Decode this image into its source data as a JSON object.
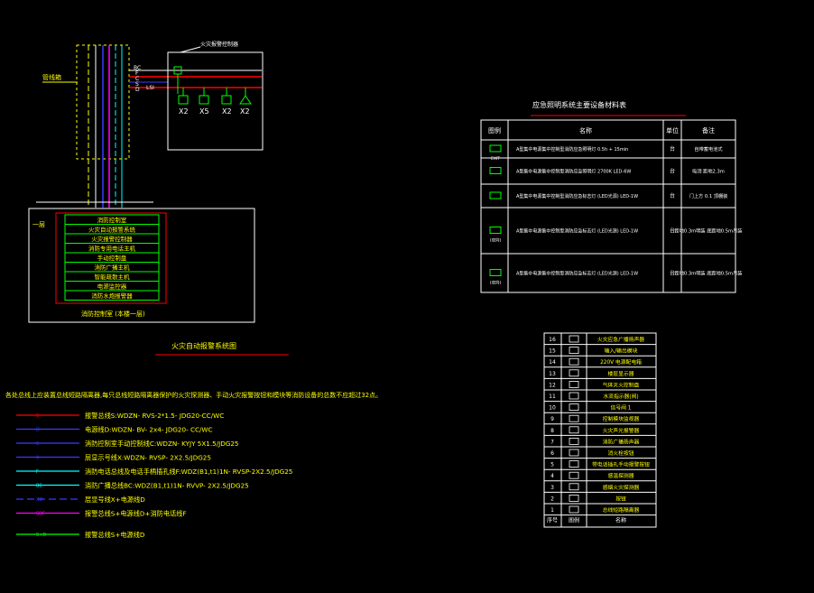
{
  "colors": {
    "background": "#000000",
    "white": "#ffffff",
    "yellow": "#ffff00",
    "green": "#00ff00",
    "red": "#ff0000",
    "cyan": "#00ffff",
    "magenta": "#ff00ff",
    "blue": "#3a3aff",
    "gray": "#9a9a9a"
  },
  "riser": {
    "shaft_label": "管线箱",
    "box_label": "火灾报警控制器",
    "floor_label": "一层",
    "line_tags": [
      "BC",
      "F",
      "C",
      "S",
      "D"
    ],
    "module_tag": "LSI",
    "devices": [
      "X2",
      "X5",
      "X2",
      "X2"
    ],
    "panel_items": [
      "消防控制室",
      "火灾自动报警系统",
      "火灾报警控制器",
      "消防专用电话主机",
      "手动控制盘",
      "消防广播主机",
      "智能疏散主机",
      "电源监控器",
      "消防水炮报警器"
    ],
    "panel_footer": "消防控制室    (本楼一层)",
    "title": "火灾自动报警系统图"
  },
  "notes": {
    "main": "各处总线上应装置总线短路隔离器,每只总线短路隔离器保护的火灾探测器、手动火灾报警按钮和模块等消防设备的总数不应超过32点。"
  },
  "legend": [
    {
      "tag": "S",
      "text": "报警总线S:WDZN- RVS-2*1.5- JDG20-CC/WC",
      "color": "red",
      "dashed": false
    },
    {
      "tag": "D",
      "text": "电源线D:WDZN- BV- 2x4- JDG20- CC/WC",
      "color": "blue",
      "dashed": false
    },
    {
      "tag": "C",
      "text": "消防控制室手动控制线C:WDZN- KYJY 5X1.5/JDG25",
      "color": "blue",
      "dashed": false
    },
    {
      "tag": "X",
      "text": "层显示号线X:WDZN- RVSP- 2X2.5/JDG25",
      "color": "blue",
      "dashed": false
    },
    {
      "tag": "F",
      "text": "消防电话总线及电话手柄插孔线F:WDZ(B1,t1)1N- RVSP-2X2.5/JDG25",
      "color": "cyan",
      "dashed": false
    },
    {
      "tag": "BC",
      "text": "消防广播总线BC:WDZ(B1,t1)1N- RVVP- 2X2.5/JDG25",
      "color": "cyan",
      "dashed": false
    },
    {
      "tag": "XD",
      "text": "层显号线X+电源线D",
      "color": "blue",
      "dashed": true
    },
    {
      "tag": "SDF",
      "text": "报警总线S+电源线D+消防电话线F",
      "color": "magenta",
      "dashed": false
    },
    {
      "tag": "S+D",
      "text": "报警总线S+电源线D",
      "color": "green",
      "dashed": false
    }
  ],
  "materials": {
    "title": "应急照明系统主要设备材料表",
    "headers": [
      "图例",
      "名称",
      "单位",
      "备注"
    ],
    "rows": [
      {
        "legend": "EXIT",
        "name": "A型集中电源集中控制型消防应急照明灯 0.5h + 15min",
        "unit": "台",
        "note": "自带蓄电池式"
      },
      {
        "legend": "",
        "name": "A型集中电源集中控制型消防应急照明灯 2700K LED-6W",
        "unit": "台",
        "note": "吸顶 距地2.3m"
      },
      {
        "legend": "",
        "name": "A型集中电源集中控制型消防应急标志灯 (LED光源) LED-1W",
        "unit": "台",
        "note": "门上方 0.1 顶棚装"
      },
      {
        "legend": "(双向)",
        "name": "A型集中电源集中控制型消防应急标志灯 (LED光源) LED-1W",
        "unit": "台",
        "note": "距地0.3m明装 底距地0.5m吊装"
      },
      {
        "legend": "(双向)",
        "name": "A型集中电源集中控制型消防应急标志灯 (LED光源) LED-1W",
        "unit": "台",
        "note": "距地0.3m明装 底距地0.5m吊装"
      }
    ]
  },
  "symbols": {
    "rows": [
      {
        "no": "16",
        "name": "火灾应急广播扬声器"
      },
      {
        "no": "15",
        "name": "输入/输出模块"
      },
      {
        "no": "14",
        "name": "220V 电源配电箱"
      },
      {
        "no": "13",
        "name": "楼层显示器"
      },
      {
        "no": "12",
        "name": "气体灭火控制盘"
      },
      {
        "no": "11",
        "name": "水流指示器(阀)"
      },
      {
        "no": "10",
        "name": "信号阀 1"
      },
      {
        "no": "9",
        "name": "控制模块监视器"
      },
      {
        "no": "8",
        "name": "火灾声光报警器"
      },
      {
        "no": "7",
        "name": "消防广播扬声器"
      },
      {
        "no": "6",
        "name": "消火栓按钮"
      },
      {
        "no": "5",
        "name": "带电话插孔手动报警按钮"
      },
      {
        "no": "4",
        "name": "感温探测器"
      },
      {
        "no": "3",
        "name": "感烟火灾探测器"
      },
      {
        "no": "2",
        "name": "按钮"
      },
      {
        "no": "1",
        "name": "总线短路隔离器"
      }
    ],
    "footer_no": "序号",
    "footer_legend": "图例",
    "footer_name": "名称"
  }
}
